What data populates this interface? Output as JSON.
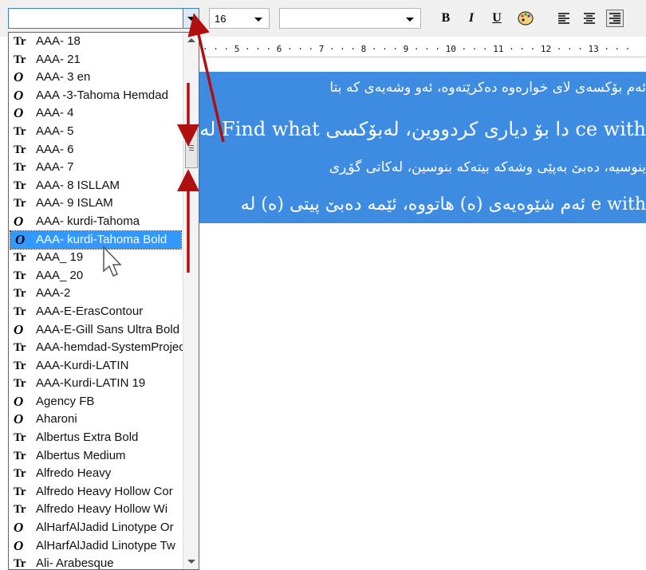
{
  "toolbar": {
    "font_value": "",
    "size_value": "16",
    "style_value": "",
    "bold_label": "B",
    "italic_label": "I",
    "underline_label": "U"
  },
  "ruler": {
    "text": "· · · 5 · · · 6 · · · 7 · · · 8 · · · 9 · · · 10 · · · 11 · · · 12 · · · 13 · · ·"
  },
  "document": {
    "lines": [
      "ئەم بۆکسەی لای خوارەوە دەکرێتەوە، ئەو وشەیەی کە بتا",
      "لە Find what دا بۆ دیاری کردووین، لەبۆکسی ce with",
      "ینوسیە، دەبێ بەپێی وشەکە بیتەکە بنوسین، لەکاتی گۆڕی",
      "ئەم شێوەیەی (ە) هاتووە، ئێمە دەبێ پیتی (ە) لە e with"
    ]
  },
  "font_list": {
    "items": [
      {
        "label": "AAA- 18",
        "type": "truetype"
      },
      {
        "label": "AAA- 21",
        "type": "truetype"
      },
      {
        "label": "AAA- 3 en",
        "type": "opentype"
      },
      {
        "label": "AAA -3-Tahoma Hemdad",
        "type": "opentype"
      },
      {
        "label": "AAA- 4",
        "type": "opentype"
      },
      {
        "label": "AAA- 5",
        "type": "truetype"
      },
      {
        "label": "AAA- 6",
        "type": "truetype"
      },
      {
        "label": "AAA- 7",
        "type": "truetype"
      },
      {
        "label": "AAA- 8 ISLLAM",
        "type": "truetype"
      },
      {
        "label": "AAA- 9 ISLAM",
        "type": "truetype"
      },
      {
        "label": "AAA- kurdi-Tahoma",
        "type": "opentype"
      },
      {
        "label": "AAA- kurdi-Tahoma Bold",
        "type": "opentype",
        "selected": true
      },
      {
        "label": "AAA_ 19",
        "type": "truetype"
      },
      {
        "label": "AAA_ 20",
        "type": "truetype"
      },
      {
        "label": "AAA-2",
        "type": "truetype"
      },
      {
        "label": "AAA-E-ErasContour",
        "type": "truetype"
      },
      {
        "label": "AAA-E-Gill Sans Ultra Bold",
        "type": "opentype"
      },
      {
        "label": "AAA-hemdad-SystemProject",
        "type": "truetype"
      },
      {
        "label": "AAA-Kurdi-LATIN",
        "type": "truetype"
      },
      {
        "label": "AAA-Kurdi-LATIN 19",
        "type": "truetype"
      },
      {
        "label": "Agency FB",
        "type": "opentype"
      },
      {
        "label": "Aharoni",
        "type": "opentype"
      },
      {
        "label": "Albertus Extra Bold",
        "type": "truetype"
      },
      {
        "label": "Albertus Medium",
        "type": "truetype"
      },
      {
        "label": "Alfredo Heavy",
        "type": "truetype"
      },
      {
        "label": "Alfredo Heavy Hollow Cor",
        "type": "truetype"
      },
      {
        "label": "Alfredo Heavy Hollow Wi",
        "type": "truetype"
      },
      {
        "label": "AlHarfAlJadid Linotype Or",
        "type": "opentype"
      },
      {
        "label": "AlHarfAlJadid Linotype Tw",
        "type": "opentype"
      },
      {
        "label": "Ali- Arabesque",
        "type": "truetype"
      }
    ]
  },
  "colors": {
    "selection": "#3e8ce1",
    "list_highlight": "#3399ff",
    "annotation_arrow": "#b01010"
  },
  "icons": {
    "truetype": "truetype-font-icon",
    "opentype": "opentype-font-icon",
    "cursor": "mouse-pointer-icon"
  }
}
